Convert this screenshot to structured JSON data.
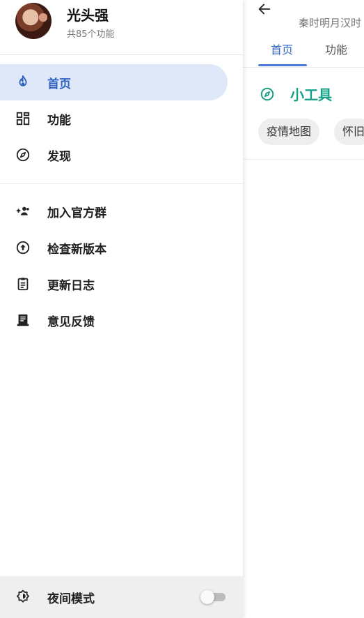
{
  "profile": {
    "name": "光头强",
    "subtitle": "共85个功能"
  },
  "drawer": {
    "primary_items": [
      {
        "label": "首页",
        "icon": "flame-icon",
        "active": true
      },
      {
        "label": "功能",
        "icon": "grid-icon",
        "active": false
      },
      {
        "label": "发现",
        "icon": "compass-icon",
        "active": false
      }
    ],
    "secondary_items": [
      {
        "label": "加入官方群",
        "icon": "group-add-icon"
      },
      {
        "label": "检查新版本",
        "icon": "upgrade-icon"
      },
      {
        "label": "更新日志",
        "icon": "clipboard-icon"
      },
      {
        "label": "意见反馈",
        "icon": "feedback-icon"
      }
    ],
    "night_mode": {
      "label": "夜间模式",
      "icon": "brightness-icon",
      "enabled": false
    }
  },
  "page": {
    "subtitle": "秦时明月汉时",
    "tabs": [
      {
        "label": "首页",
        "active": true
      },
      {
        "label": "功能",
        "active": false
      }
    ],
    "section": {
      "title": "小工具",
      "icon": "compass-icon",
      "chips": [
        "疫情地图",
        "怀旧"
      ]
    }
  },
  "colors": {
    "accent_blue": "#2f63c4",
    "active_bg": "#dfe8f8",
    "teal": "#16a085",
    "chip_bg": "#eeeeee"
  }
}
